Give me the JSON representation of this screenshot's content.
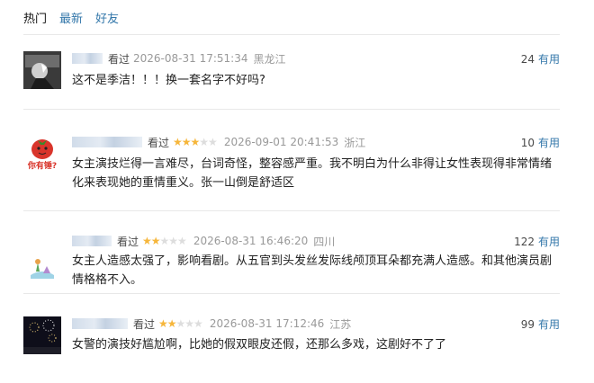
{
  "tabs": [
    "热门",
    "最新",
    "好友"
  ],
  "comments": [
    {
      "status": "看过",
      "stars": 0,
      "time": "2026-08-31 17:51:34",
      "location": "黑龙江",
      "votes": "24",
      "useful": "有用",
      "content": "这不是季洁！！！换一套名字不好吗?"
    },
    {
      "status": "看过",
      "stars": 3,
      "time": "2026-09-01 20:41:53",
      "location": "浙江",
      "votes": "10",
      "useful": "有用",
      "avatar_text": "你有锤?",
      "content": "女主演技烂得一言难尽，台词奇怪，整容感严重。我不明白为什么非得让女性表现得非常情绪化来表现她的重情重义。张一山倒是舒适区"
    },
    {
      "status": "看过",
      "stars": 2,
      "time": "2026-08-31 16:46:20",
      "location": "四川",
      "votes": "122",
      "useful": "有用",
      "content": "女主人造感太强了，影响看剧。从五官到头发丝发际线颅顶耳朵都充满人造感。和其他演员剧情格格不入。"
    },
    {
      "status": "看过",
      "stars": 2,
      "time": "2026-08-31 17:12:46",
      "location": "江苏",
      "votes": "99",
      "useful": "有用",
      "content": "女警的演技好尴尬啊，比她的假双眼皮还假，还那么多戏，这剧好不了了"
    }
  ],
  "colors": {
    "link": "#3377aa",
    "star": "#f6b63b",
    "meta": "#999999"
  }
}
